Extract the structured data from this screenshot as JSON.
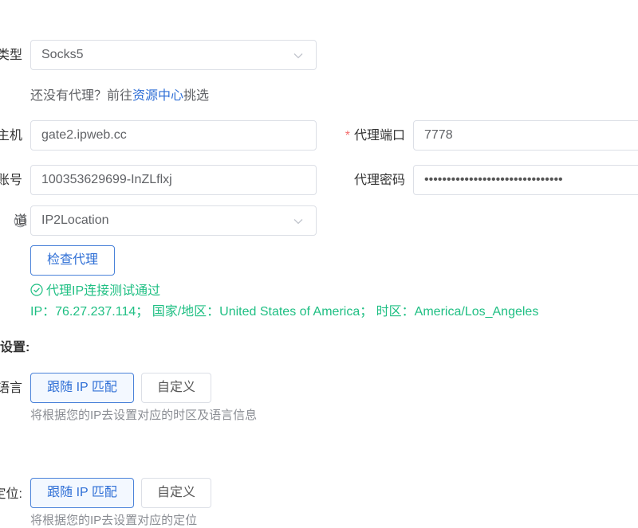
{
  "proxy_type": {
    "label": "类型",
    "value": "Socks5"
  },
  "no_proxy_hint": {
    "prefix": "还没有代理？前往",
    "link": "资源中心",
    "suffix": "挑选"
  },
  "host": {
    "label": "主机",
    "value": "gate2.ipweb.cc"
  },
  "port": {
    "label": "代理端口",
    "value": "7778"
  },
  "account": {
    "label": "账号",
    "value": "100353629699-InZLflxj"
  },
  "password": {
    "label": "代理密码",
    "value": "•••••••••••••••••••••••••••••••"
  },
  "channel": {
    "label": "道",
    "value": "IP2Location"
  },
  "check_button": {
    "label": "检查代理"
  },
  "check_result": {
    "status": "代理IP连接测试通过",
    "details": "IP：76.27.237.114； 国家/地区：United States of America； 时区：America/Los_Angeles"
  },
  "settings_heading": "设置:",
  "language": {
    "label": "语言",
    "option_follow": "跟随 IP 匹配",
    "option_custom": "自定义",
    "hint": "将根据您的IP去设置对应的时区及语言信息"
  },
  "location": {
    "label": "定位:",
    "option_follow": "跟随 IP 匹配",
    "option_custom": "自定义",
    "hint": "将根据您的IP去设置对应的定位"
  },
  "colors": {
    "primary": "#2f6fd6",
    "success": "#1fbf83",
    "required": "#f56c6c",
    "border": "#dcdfe6"
  }
}
